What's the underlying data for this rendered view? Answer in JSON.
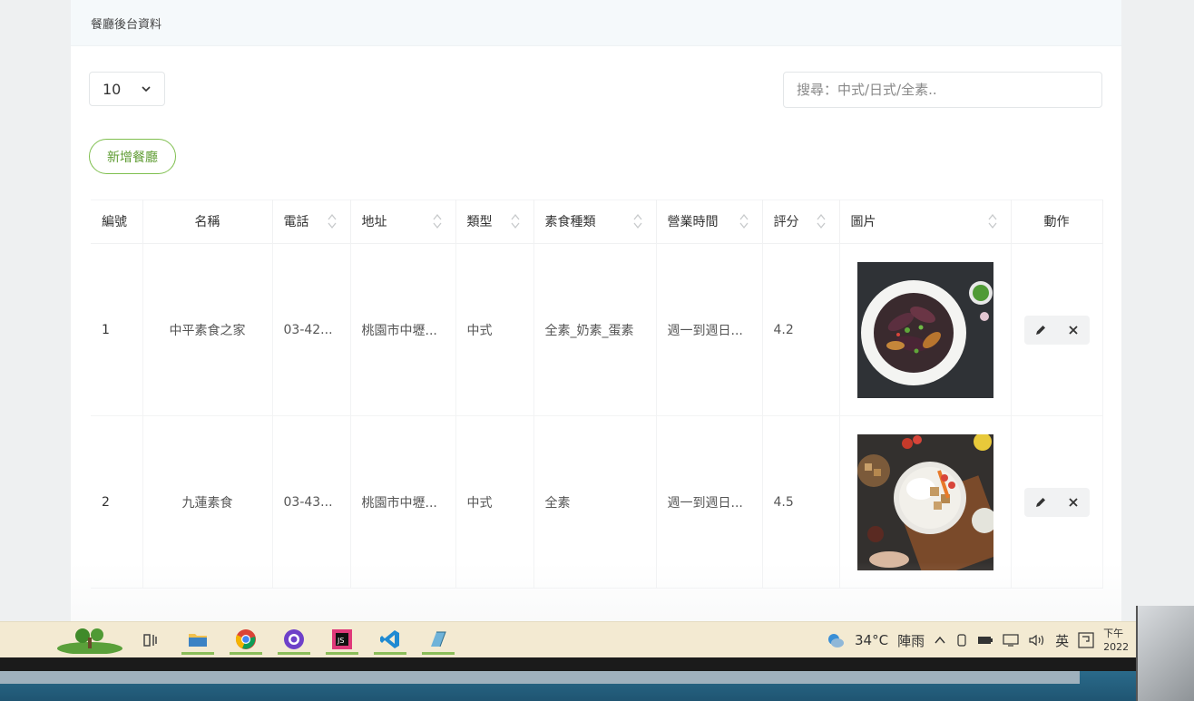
{
  "header": {
    "title": "餐廳後台資料"
  },
  "controls": {
    "page_size": "10",
    "search_placeholder": "搜尋：中式/日式/全素..",
    "add_button": "新增餐廳"
  },
  "table": {
    "columns": [
      "編號",
      "名稱",
      "電話",
      "地址",
      "類型",
      "素食種類",
      "營業時間",
      "評分",
      "圖片",
      "動作"
    ],
    "rows": [
      {
        "id": "1",
        "name": "中平素食之家",
        "phone": "03-42...",
        "address": "桃園市中壢...",
        "type": "中式",
        "veg": "全素_奶素_蛋素",
        "hours": "週一到週日...",
        "rating": "4.2",
        "image": "eggplant-dish-image"
      },
      {
        "id": "2",
        "name": "九蓮素食",
        "phone": "03-43...",
        "address": "桃園市中壢...",
        "type": "中式",
        "veg": "全素",
        "hours": "週一到週日...",
        "rating": "4.5",
        "image": "rice-bowl-image"
      }
    ]
  },
  "taskbar": {
    "weather": "34°C",
    "weather_desc": "陣雨",
    "ime": "英",
    "clock_partial": "下午",
    "date_partial": "2022"
  },
  "colors": {
    "accent": "#5f9c33",
    "taskbar": "#f3ead2"
  }
}
